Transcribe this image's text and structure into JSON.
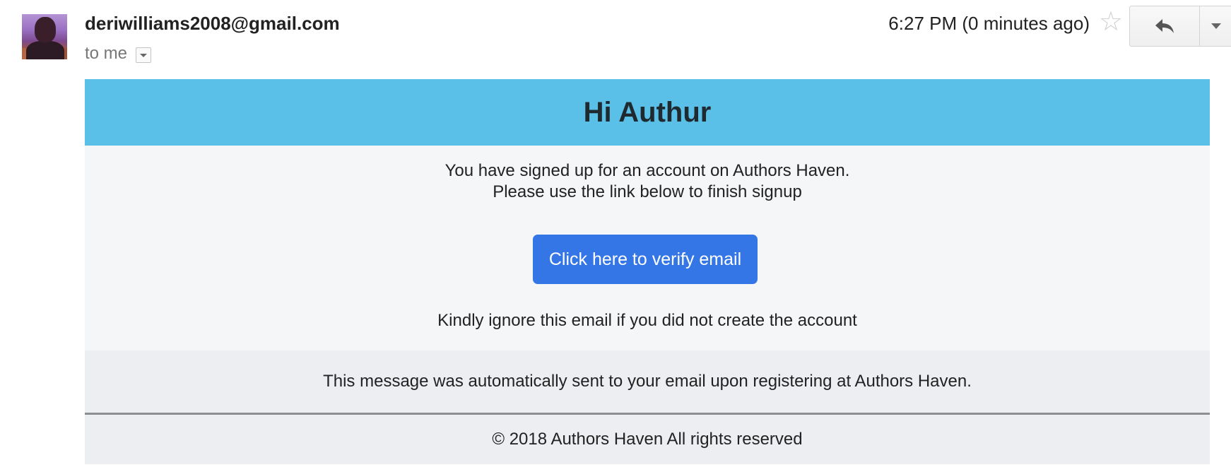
{
  "message": {
    "sender_email": "deriwilliams2008@gmail.com",
    "recipient_label": "to me",
    "timestamp": "6:27 PM (0 minutes ago)"
  },
  "icons": {
    "avatar": "profile-photo",
    "recipient_toggle": "dropdown-arrow-icon",
    "star": "star-outline-icon",
    "reply": "reply-arrow-icon",
    "more": "chevron-down-icon"
  },
  "email": {
    "greeting": "Hi Authur",
    "intro_line_1": "You have signed up for an account on Authors Haven.",
    "intro_line_2": "Please use the link below to finish signup",
    "verify_button": "Click here to verify email",
    "ignore_note": "Kindly ignore this email if you did not create the account",
    "auto_note": "This message was automatically sent to your email upon registering at Authors Haven.",
    "copyright": "© 2018 Authors Haven All rights reserved"
  },
  "colors": {
    "header_bg": "#5bc0e8",
    "button_bg": "#3576e6",
    "content_bg": "#f5f6f8",
    "footer_bg": "#eceef2"
  }
}
